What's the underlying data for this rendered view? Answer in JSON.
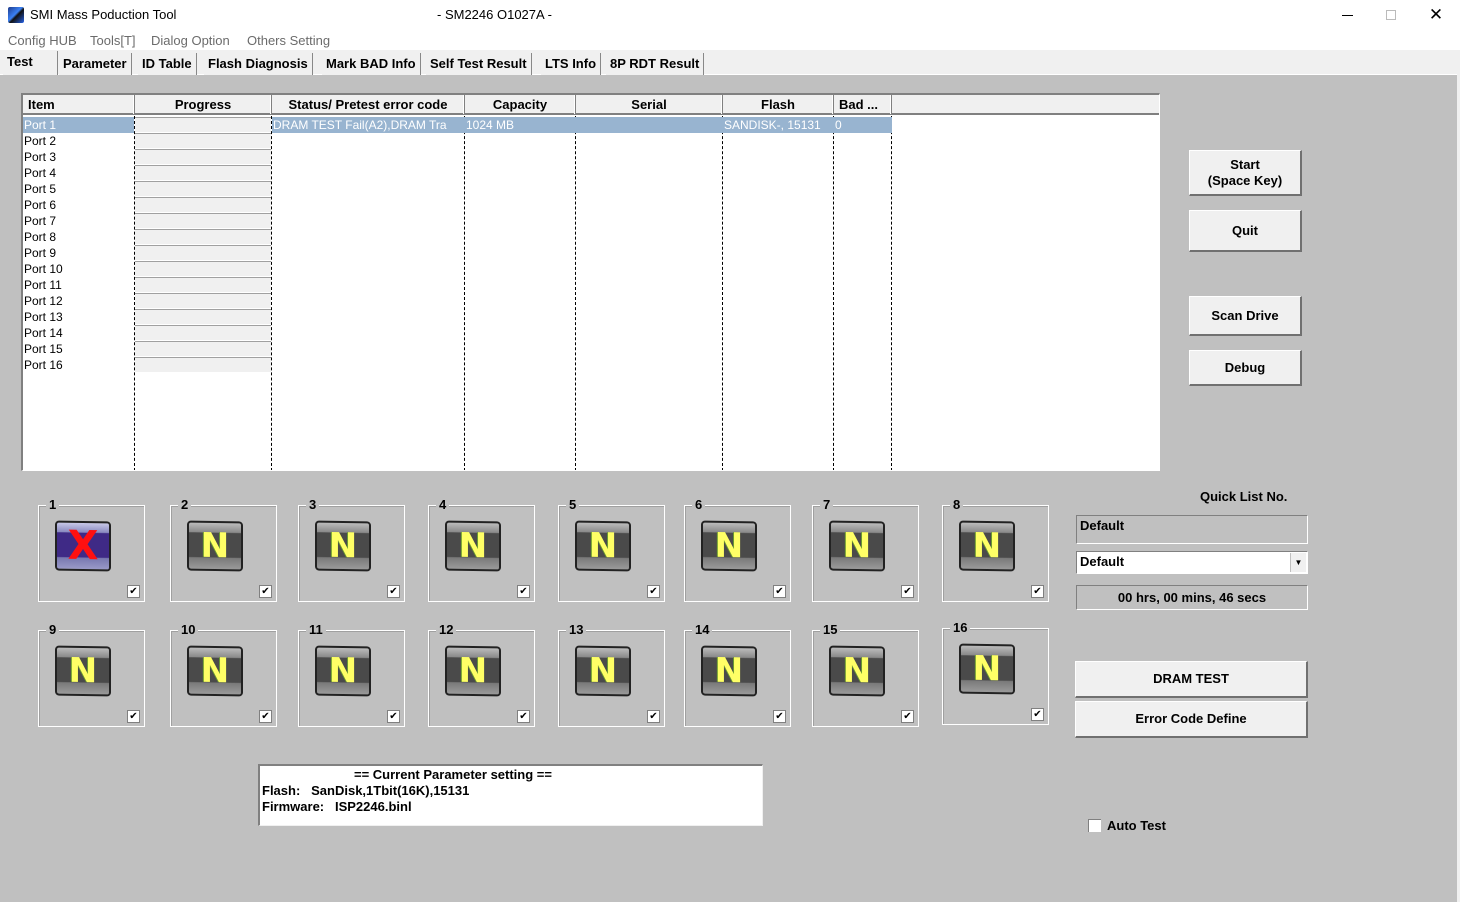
{
  "window": {
    "title": "SMI Mass Poduction Tool",
    "subtitle": "- SM2246 O1027A -",
    "controls": {
      "minimize": "minimize",
      "maximize": "maximize",
      "close": "✕"
    }
  },
  "menu": [
    "Config HUB",
    "Tools[T]",
    "Dialog Option",
    "Others Setting"
  ],
  "tabs": [
    {
      "label": "Test",
      "active": true
    },
    {
      "label": "Parameter"
    },
    {
      "label": "ID Table"
    },
    {
      "label": "Flash Diagnosis"
    },
    {
      "label": "Mark BAD Info"
    },
    {
      "label": "Self Test Result"
    },
    {
      "label": "LTS Info"
    },
    {
      "label": "8P RDT Result"
    }
  ],
  "grid": {
    "columns": [
      "Item",
      "Progress",
      "Status/ Pretest error code",
      "Capacity",
      "Serial",
      "Flash",
      "Bad ..."
    ],
    "rows": [
      {
        "item": "Port 1",
        "progress": 0,
        "status": "DRAM TEST Fail(A2),DRAM Tra",
        "capacity": "1024 MB",
        "serial": "",
        "flash": "SANDISK-, 15131",
        "bad": "0",
        "selected": true
      },
      {
        "item": "Port 2"
      },
      {
        "item": "Port 3"
      },
      {
        "item": "Port 4"
      },
      {
        "item": "Port 5"
      },
      {
        "item": "Port 6"
      },
      {
        "item": "Port 7"
      },
      {
        "item": "Port 8"
      },
      {
        "item": "Port 9"
      },
      {
        "item": "Port 10"
      },
      {
        "item": "Port 11"
      },
      {
        "item": "Port 12"
      },
      {
        "item": "Port 13"
      },
      {
        "item": "Port 14"
      },
      {
        "item": "Port 15"
      },
      {
        "item": "Port 16"
      }
    ]
  },
  "buttons": {
    "start": "Start\n(Space Key)",
    "start_line1": "Start",
    "start_line2": "(Space Key)",
    "quit": "Quit",
    "scan_drive": "Scan Drive",
    "debug": "Debug",
    "dram_test": "DRAM TEST",
    "error_code_define": "Error Code Define"
  },
  "ports": [
    {
      "label": "1",
      "state": "fail",
      "glyph": "X",
      "checked": true
    },
    {
      "label": "2",
      "state": "none",
      "glyph": "N",
      "checked": true
    },
    {
      "label": "3",
      "state": "none",
      "glyph": "N",
      "checked": true
    },
    {
      "label": "4",
      "state": "none",
      "glyph": "N",
      "checked": true
    },
    {
      "label": "5",
      "state": "none",
      "glyph": "N",
      "checked": true
    },
    {
      "label": "6",
      "state": "none",
      "glyph": "N",
      "checked": true
    },
    {
      "label": "7",
      "state": "none",
      "glyph": "N",
      "checked": true
    },
    {
      "label": "8",
      "state": "none",
      "glyph": "N",
      "checked": true
    },
    {
      "label": "9",
      "state": "none",
      "glyph": "N",
      "checked": true
    },
    {
      "label": "10",
      "state": "none",
      "glyph": "N",
      "checked": true
    },
    {
      "label": "11",
      "state": "none",
      "glyph": "N",
      "checked": true
    },
    {
      "label": "12",
      "state": "none",
      "glyph": "N",
      "checked": true
    },
    {
      "label": "13",
      "state": "none",
      "glyph": "N",
      "checked": true
    },
    {
      "label": "14",
      "state": "none",
      "glyph": "N",
      "checked": true
    },
    {
      "label": "15",
      "state": "none",
      "glyph": "N",
      "checked": true
    },
    {
      "label": "16",
      "state": "none",
      "glyph": "N",
      "checked": true
    }
  ],
  "quick_list": {
    "label": "Quick List No.",
    "field_value": "Default",
    "select_value": "Default",
    "arrow": "▼"
  },
  "timer": "00 hrs, 00 mins, 46 secs",
  "parameters": {
    "title": "== Current Parameter setting ==",
    "flash": "Flash:   SanDisk,1Tbit(16K),15131",
    "firmware": "Firmware:   ISP2246.binl"
  },
  "auto_test": {
    "label": "Auto Test",
    "checked": false
  },
  "check_glyph": "✔"
}
